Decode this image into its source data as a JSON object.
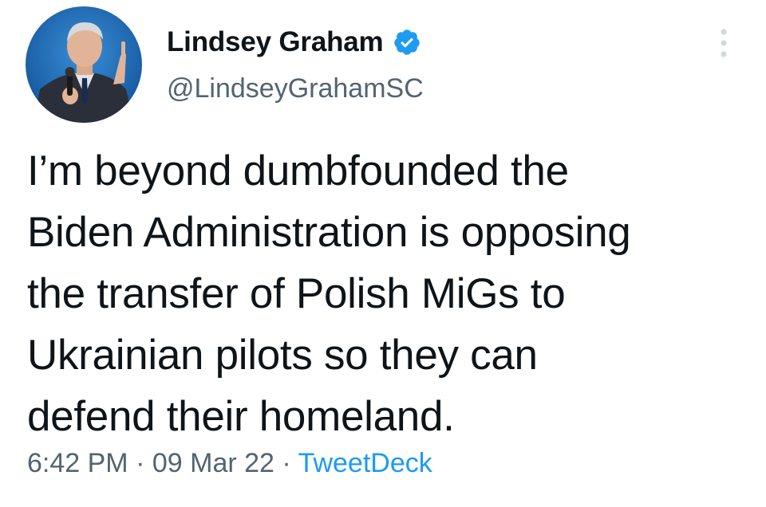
{
  "author": {
    "display_name": "Lindsey Graham",
    "handle": "@LindseyGrahamSC",
    "verified": true,
    "avatar_icon": "profile-photo",
    "verified_icon": "verified-badge-icon"
  },
  "tweet": {
    "lines": [
      "I’m beyond dumbfounded the",
      "Biden Administration is opposing",
      "the transfer of Polish MiGs to",
      "Ukrainian pilots so they can",
      "defend their homeland."
    ]
  },
  "meta": {
    "time": "6:42 PM",
    "separator_1": "·",
    "date": "09 Mar 22",
    "separator_2": "·",
    "source": "TweetDeck"
  },
  "menu": {
    "icon": "more-options-icon"
  },
  "colors": {
    "text": "#0f1419",
    "secondary": "#536471",
    "accent": "#1d9bf0",
    "background": "#ffffff"
  }
}
